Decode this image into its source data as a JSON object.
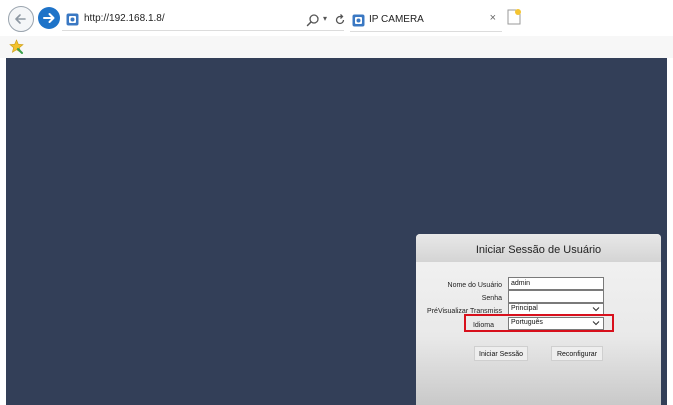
{
  "browser": {
    "url": "http://192.168.1.8/",
    "tab_title": "IP CAMERA",
    "tab_close": "×"
  },
  "login": {
    "title": "Iniciar Sessão de Usuário",
    "username_label": "Nome do Usuário",
    "username_value": "admin",
    "password_label": "Senha",
    "password_value": "",
    "stream_label": "PréVisualizar Transmiss",
    "stream_value": "Principal",
    "language_label": "Idioma",
    "language_value": "Português",
    "login_button": "Iniciar Sessão",
    "reset_button": "Reconfigurar"
  },
  "colors": {
    "page_background": "#333f58",
    "highlight": "#d8101c",
    "nav_forward": "#1e73c8"
  },
  "icons": {
    "back": "back-arrow-icon",
    "forward": "forward-arrow-icon",
    "search": "search-icon",
    "refresh": "refresh-icon",
    "favorites": "favorites-star-icon",
    "new_tab": "new-tab-icon"
  }
}
